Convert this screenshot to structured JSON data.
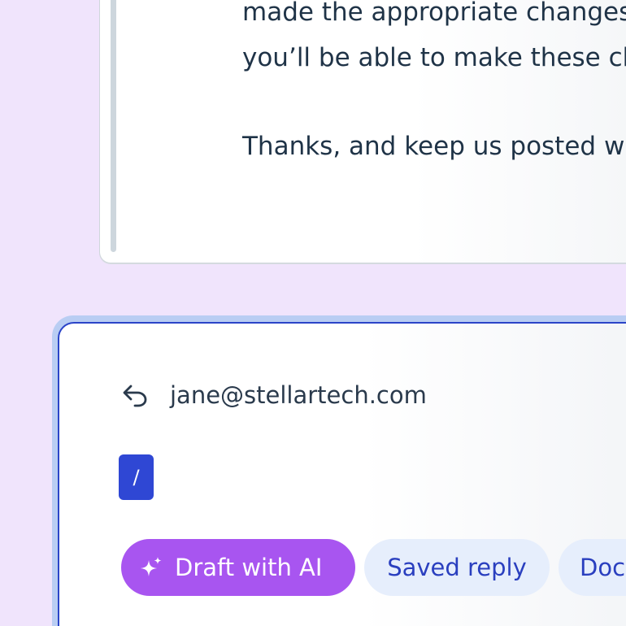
{
  "message": {
    "lines": [
      "made the appropriate changes",
      "you’ll be able to make these ch",
      "",
      "Thanks, and keep us posted w"
    ]
  },
  "composer": {
    "reply_to": "jane@stellartech.com",
    "slash_command": "/",
    "actions": {
      "draft_ai": "Draft with AI",
      "saved_reply": "Saved reply",
      "docs": "Doc"
    }
  },
  "icons": {
    "reply": "reply-arrow-icon",
    "sparkle": "sparkle-icon"
  },
  "colors": {
    "background": "#f0e4fc",
    "accent_ai": "#a855f0",
    "composer_border": "#2b44c8",
    "slash_chip": "#2f47d4",
    "chip_text": "#2a3fbf",
    "chip_bg": "#e6eefc",
    "body_text": "#1f3347"
  }
}
